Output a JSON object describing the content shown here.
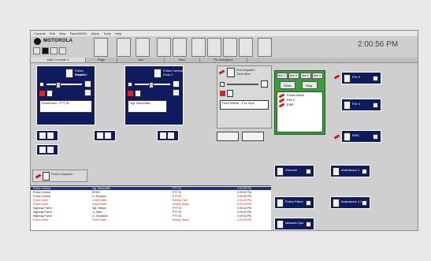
{
  "menu": {
    "items": [
      "Console",
      "Edit",
      "View",
      "Patch/MSEL",
      "Alarm",
      "Tools",
      "Help"
    ]
  },
  "brand": {
    "name": "MOTOROLA"
  },
  "clock": {
    "time": "2:00:56 PM"
  },
  "tabs": [
    "Main Console 1",
    "Page",
    "Aux",
    "Misc",
    "Pre-Assigned"
  ],
  "colors": {
    "panel": "#101a5e",
    "green": "#3f9b3f",
    "red": "#cc1a1a",
    "select": "#1f2c88"
  },
  "panels": [
    {
      "title": "Police Dispatch",
      "sub": "Zone 1",
      "field": "Downtown - PTT ID"
    },
    {
      "title": "Police Central",
      "sub": "Zone 2",
      "field": "Sgt. Benedetto"
    },
    {
      "title": "Fire Dispatch",
      "sub": "Tone Alert",
      "field": "Field Mobile - Fire Ops"
    }
  ],
  "green_panel": {
    "buttons": [
      "Aux 1",
      "Aux 2",
      "Aux 3",
      "Aux 4"
    ],
    "send": "Send",
    "stop": "Stop",
    "list": [
      "Police North",
      "Fire 2",
      "EMS"
    ]
  },
  "channels": [
    "Fire 3",
    "Fire 4",
    "EMS",
    "Channel",
    "Ambulance 1",
    "Police Patrol",
    "Ambulance 2 Ch",
    "Network Ops"
  ],
  "table": {
    "rows": [
      [
        "Police Central",
        "Sgt. Benedetto",
        "PTT ID",
        "2:00:55 PM"
      ],
      [
        "Police Central",
        "REDS",
        "PTT ID",
        "2:00:52 PM"
      ],
      [
        "Police Central",
        "Lt. Rosalee",
        "PTT ID",
        "2:00:50 PM"
      ],
      [
        "Police North",
        "Chief Smith",
        "Emerg. Call",
        "2:00:48 PM"
      ],
      [
        "Police North",
        "Chief Smith",
        "Emerg. Alarm",
        "2:00:46 PM"
      ],
      [
        "Highway Patrol",
        "Sgt. Nelson",
        "PTT ID",
        "2:00:44 PM"
      ],
      [
        "Highway Patrol",
        "Lt. Allen",
        "PTT ID",
        "2:00:42 PM"
      ],
      [
        "Highway Patrol",
        "Lt. Geraldine",
        "PTT ID",
        "2:00:40 PM"
      ],
      [
        "Police North",
        "Chief Smith",
        "Emerg. Alarm",
        "2:00:38 PM"
      ]
    ]
  }
}
